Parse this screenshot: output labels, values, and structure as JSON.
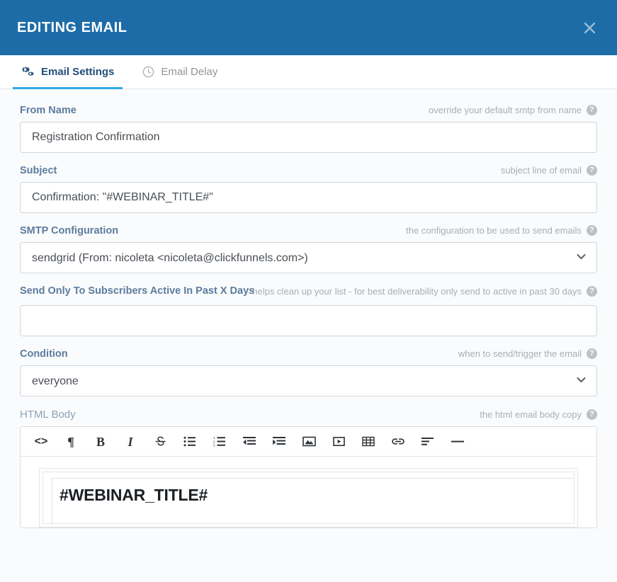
{
  "header": {
    "title": "EDITING EMAIL",
    "close_label": "×",
    "bg_color": "#1d6ca8"
  },
  "tabs": [
    {
      "label": "Email Settings",
      "icon": "cogs-icon",
      "active": true
    },
    {
      "label": "Email Delay",
      "icon": "clock-icon",
      "active": false
    }
  ],
  "accent_color": "#2fa8e8",
  "label_color": "#5c7c9e",
  "fields": {
    "from_name": {
      "label": "From Name",
      "hint": "override your default smtp from name",
      "value": "Registration Confirmation",
      "placeholder": ""
    },
    "subject": {
      "label": "Subject",
      "hint": "subject line of email",
      "value": "Confirmation: \"#WEBINAR_TITLE#\"",
      "placeholder": ""
    },
    "smtp_configuration": {
      "label": "SMTP Configuration",
      "hint": "the configuration to be used to send emails",
      "value": "sendgrid (From: nicoleta <nicoleta@clickfunnels.com>)"
    },
    "send_only_active": {
      "label": "Send Only To Subscribers Active In Past X Days",
      "hint": "helps clean up your list - for best deliverability only send to active in past 30 days",
      "value": "",
      "placeholder": ""
    },
    "condition": {
      "label": "Condition",
      "hint": "when to send/trigger the email",
      "value": "everyone"
    },
    "html_body": {
      "label": "HTML Body",
      "hint": "the html email body copy"
    }
  },
  "editor": {
    "toolbar": [
      {
        "name": "code-icon",
        "glyph": "<>"
      },
      {
        "name": "paragraph-icon",
        "glyph": "¶"
      },
      {
        "name": "bold-icon",
        "glyph": "B"
      },
      {
        "name": "italic-icon",
        "glyph": "I"
      },
      {
        "name": "strikethrough-icon",
        "glyph": "S"
      },
      {
        "name": "bullet-list-icon",
        "glyph": ""
      },
      {
        "name": "numbered-list-icon",
        "glyph": ""
      },
      {
        "name": "outdent-icon",
        "glyph": ""
      },
      {
        "name": "indent-icon",
        "glyph": ""
      },
      {
        "name": "image-icon",
        "glyph": ""
      },
      {
        "name": "video-icon",
        "glyph": ""
      },
      {
        "name": "table-icon",
        "glyph": ""
      },
      {
        "name": "link-icon",
        "glyph": ""
      },
      {
        "name": "align-left-icon",
        "glyph": ""
      },
      {
        "name": "horizontal-rule-icon",
        "glyph": ""
      }
    ],
    "content_title": "#WEBINAR_TITLE#"
  }
}
